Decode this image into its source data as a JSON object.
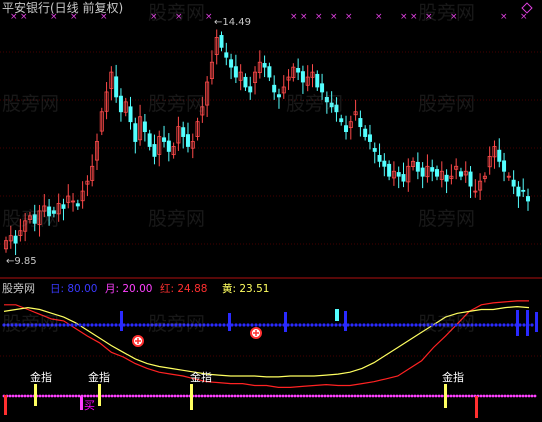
{
  "header": {
    "title": "平安银行(日线 前复权)",
    "high_marker": "14.49",
    "low_marker": "9.85"
  },
  "indicator": {
    "name": "股旁网",
    "legend": [
      {
        "key": "blue",
        "label": "日:",
        "value": "80.00",
        "color": "#3a3aff"
      },
      {
        "key": "purple",
        "label": "月:",
        "value": "20.00",
        "color": "#ff40ff"
      },
      {
        "key": "red",
        "label": "红:",
        "value": "24.88",
        "color": "#ff3030"
      },
      {
        "key": "yellow",
        "label": "黄:",
        "value": "23.51",
        "color": "#ffff60"
      }
    ],
    "signals": {
      "gold": [
        "金指",
        "金指",
        "金指",
        "金指"
      ],
      "buy": "买"
    }
  },
  "watermarks": [
    "股旁网",
    "股旁网",
    "股旁网",
    "股旁网",
    "股旁网",
    "股旁网",
    "股旁网",
    "股旁网",
    "股旁网",
    "股旁网",
    "股旁网",
    "股旁网"
  ],
  "colors": {
    "up": "#ff4a4a",
    "down": "#54ffff",
    "red_line": "#ff2222",
    "yellow_line": "#ffff60",
    "blue_band": "#2a2aff",
    "magenta_band": "#ff40ff",
    "cross_mark": "#e040e0",
    "grid": "#8b0000"
  },
  "chart_data": {
    "type": "candlestick",
    "price_high": 14.49,
    "price_low": 9.85,
    "closes": [
      10.2,
      10.3,
      10.15,
      10.4,
      10.6,
      10.7,
      10.55,
      10.8,
      10.9,
      10.7,
      10.75,
      10.95,
      10.85,
      11.1,
      11.0,
      10.9,
      11.2,
      11.4,
      11.7,
      12.2,
      12.8,
      13.2,
      13.6,
      13.1,
      12.8,
      13.0,
      12.6,
      12.2,
      12.7,
      12.4,
      12.1,
      11.9,
      12.3,
      12.2,
      12.0,
      12.1,
      12.5,
      12.3,
      12.1,
      12.2,
      12.6,
      12.9,
      13.4,
      13.8,
      14.3,
      14.1,
      13.9,
      13.7,
      13.5,
      13.6,
      13.3,
      13.2,
      13.6,
      13.8,
      13.7,
      13.5,
      13.2,
      13.1,
      13.3,
      13.5,
      13.7,
      13.6,
      13.4,
      13.5,
      13.6,
      13.3,
      13.2,
      13.0,
      12.9,
      12.8,
      12.6,
      12.4,
      12.6,
      12.8,
      12.5,
      12.3,
      12.2,
      12.0,
      11.8,
      11.7,
      11.5,
      11.6,
      11.5,
      11.4,
      11.7,
      11.8,
      11.6,
      11.5,
      11.7,
      11.6,
      11.5,
      11.6,
      11.4,
      11.5,
      11.7,
      11.5,
      11.6,
      11.3,
      11.2,
      11.4,
      11.5,
      11.9,
      12.1,
      11.8,
      11.6,
      11.5,
      11.3,
      11.1,
      11.2,
      11.0
    ],
    "red_line": [
      0.95,
      0.95,
      0.9,
      0.85,
      0.8,
      0.78,
      0.7,
      0.62,
      0.55,
      0.45,
      0.4,
      0.33,
      0.28,
      0.24,
      0.22,
      0.2,
      0.17,
      0.14,
      0.13,
      0.12,
      0.12,
      0.1,
      0.1,
      0.08,
      0.08,
      0.09,
      0.1,
      0.11,
      0.1,
      0.1,
      0.12,
      0.14,
      0.17,
      0.2,
      0.28,
      0.36,
      0.5,
      0.62,
      0.75,
      0.88,
      0.95,
      0.97,
      0.98,
      0.99,
      0.99
    ],
    "yellow_line": [
      0.88,
      0.9,
      0.92,
      0.9,
      0.86,
      0.82,
      0.76,
      0.68,
      0.6,
      0.52,
      0.45,
      0.38,
      0.33,
      0.3,
      0.28,
      0.26,
      0.24,
      0.22,
      0.21,
      0.2,
      0.2,
      0.2,
      0.19,
      0.19,
      0.2,
      0.2,
      0.2,
      0.21,
      0.22,
      0.24,
      0.28,
      0.34,
      0.42,
      0.5,
      0.58,
      0.66,
      0.74,
      0.82,
      0.86,
      0.88,
      0.9,
      0.9,
      0.92,
      0.93,
      0.92
    ]
  }
}
